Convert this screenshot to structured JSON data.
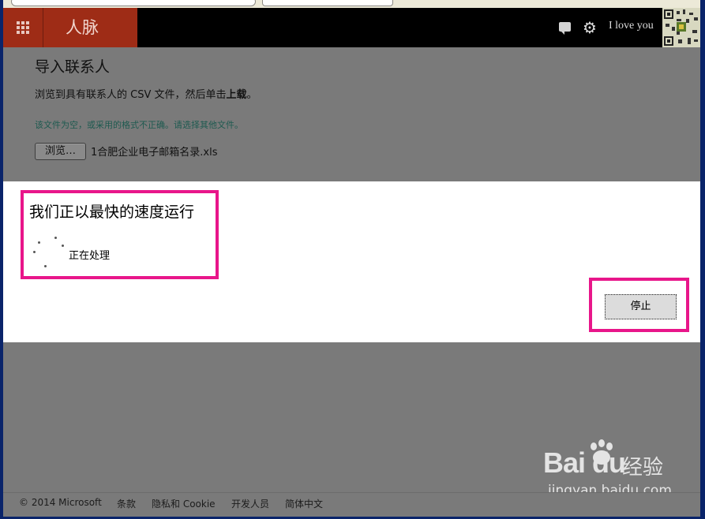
{
  "header": {
    "app_title": "人脉",
    "user_name": "I love you",
    "icons": [
      "apps-grid-icon",
      "chat-icon",
      "gear-icon"
    ]
  },
  "page": {
    "title": "导入联系人",
    "instruction_prefix": "浏览到具有联系人的 CSV 文件，然后单击",
    "instruction_bold": "上载",
    "instruction_suffix": "。",
    "error_message": "该文件为空，或采用的格式不正确。请选择其他文件。",
    "browse_button": "浏览…",
    "file_name": "1合肥企业电子邮箱名录.xls"
  },
  "modal": {
    "title": "我们正以最快的速度运行",
    "status": "正在处理",
    "stop_button": "停止"
  },
  "watermark": {
    "logo": "Bai du",
    "cn": "经验",
    "url": "jingyan.baidu.com"
  },
  "footer": {
    "copyright": "© 2014 Microsoft",
    "terms": "条款",
    "privacy": "隐私和 Cookie",
    "developers": "开发人员",
    "language": "简体中文"
  },
  "colors": {
    "accent": "#9e2c16",
    "highlight": "#e8168a",
    "overlay": "#7a7a7a"
  }
}
